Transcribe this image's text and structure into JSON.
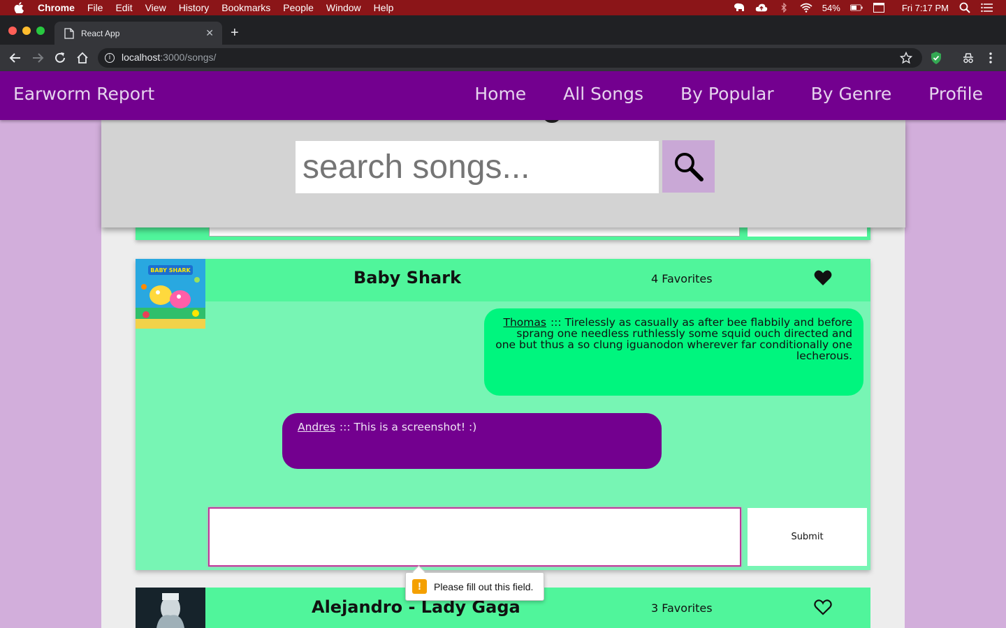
{
  "menubar": {
    "app": "Chrome",
    "items": [
      "File",
      "Edit",
      "View",
      "History",
      "Bookmarks",
      "People",
      "Window",
      "Help"
    ],
    "battery": "54%",
    "clock": "Fri 7:17 PM"
  },
  "browser": {
    "tab_title": "React App",
    "url_host": "localhost",
    "url_rest": ":3000/songs/"
  },
  "nav": {
    "brand": "Earworm Report",
    "links": [
      "Home",
      "All Songs",
      "By Popular",
      "By Genre",
      "Profile"
    ]
  },
  "search": {
    "placeholder": "search songs..."
  },
  "songs": [
    {
      "title": "Baby Shark",
      "favorites": "4 Favorites",
      "favorited": true,
      "comments": [
        {
          "author": "Thomas",
          "text": "::: Tirelessly as casually as after bee flabbily and before sprang one needless ruthlessly some squid ouch directed and one but thus a so clung iguanodon wherever far conditionally one lecherous."
        },
        {
          "author": "Andres",
          "text": "::: This is a screenshot! :)"
        }
      ],
      "submit_label": "Submit",
      "cover_text": "BABY SHARK"
    },
    {
      "title": "Alejandro - Lady Gaga",
      "favorites": "3 Favorites",
      "favorited": false
    }
  ],
  "validation": {
    "message": "Please fill out this field."
  },
  "colors": {
    "menubar": "#8b1518",
    "nav": "#73008f",
    "card_header": "#50f59b",
    "card_body": "#77f5b4",
    "comment_green": "#00f57e",
    "comment_purple": "#73008f",
    "search_button": "#c9a8d6"
  }
}
